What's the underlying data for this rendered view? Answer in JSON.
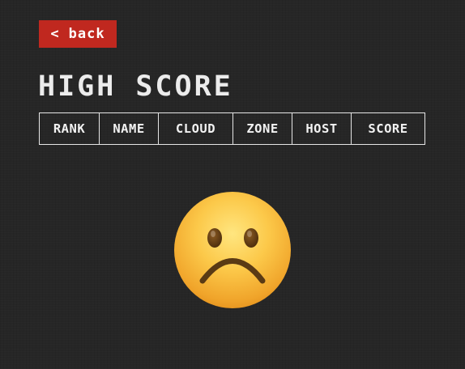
{
  "back_button": {
    "icon": "chevron-left-icon",
    "label": "back",
    "color": "#c0281f"
  },
  "title": "HIGH SCORE",
  "table": {
    "columns": [
      "RANK",
      "NAME",
      "CLOUD",
      "ZONE",
      "HOST",
      "SCORE"
    ],
    "rows": []
  },
  "empty_state": {
    "icon": "sad-face-icon"
  },
  "colors": {
    "background": "#262626",
    "text": "#f2f2f2",
    "accent": "#c0281f"
  }
}
